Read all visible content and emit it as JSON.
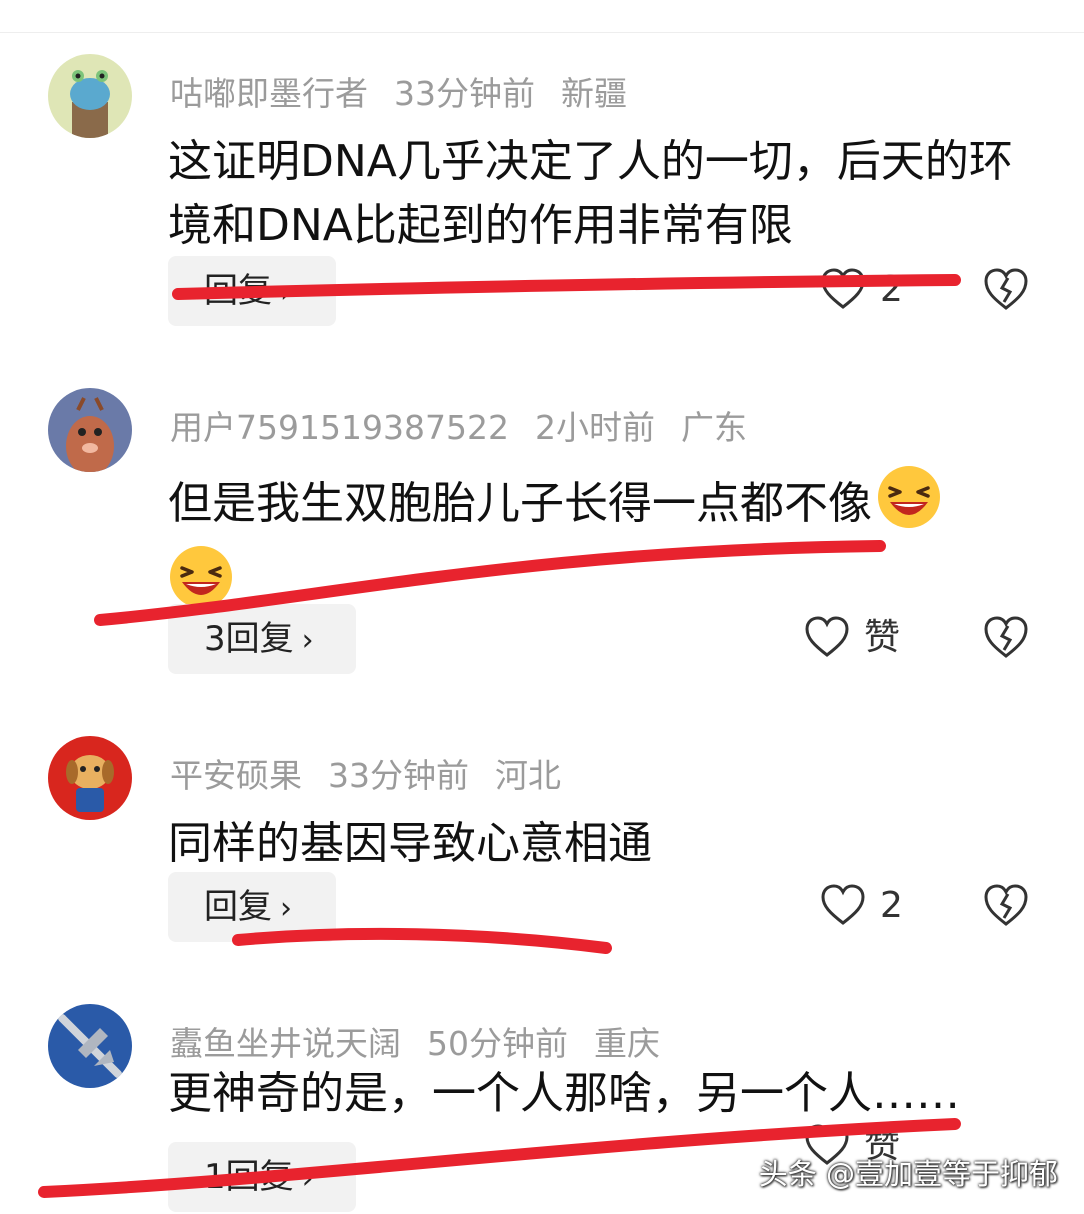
{
  "comments": [
    {
      "user": "咕嘟即墨行者",
      "time": "33分钟前",
      "location": "新疆",
      "text": "这证明DNA几乎决定了人的一切，后天的环境和DNA比起到的作用非常有限",
      "reply_label": "回复",
      "like_count": "2",
      "avatar_icon": "cartoon-avatar-icon"
    },
    {
      "user": "用户7591519387522",
      "time": "2小时前",
      "location": "广东",
      "text": "但是我生双胞胎儿子长得一点都不像",
      "reply_label": "3回复",
      "like_count": "赞",
      "avatar_icon": "cartoon-deer-avatar-icon"
    },
    {
      "user": "平安硕果",
      "time": "33分钟前",
      "location": "河北",
      "text": "同样的基因导致心意相通",
      "reply_label": "回复",
      "like_count": "2",
      "avatar_icon": "cartoon-dog-avatar-icon"
    },
    {
      "user": "蠹鱼坐井说天阔",
      "time": "50分钟前",
      "location": "重庆",
      "text": "更神奇的是，一个人那啥，另一个人……",
      "reply_label": "1回复",
      "like_count": "赞",
      "avatar_icon": "jet-plane-avatar-icon"
    }
  ],
  "watermark": "头条 @壹加壹等于抑郁",
  "colors": {
    "meta_gray": "#9b9b9b",
    "scribble_red": "#e8232e",
    "button_bg": "#f2f2f2",
    "emoji_yellow": "#ffc83d"
  }
}
